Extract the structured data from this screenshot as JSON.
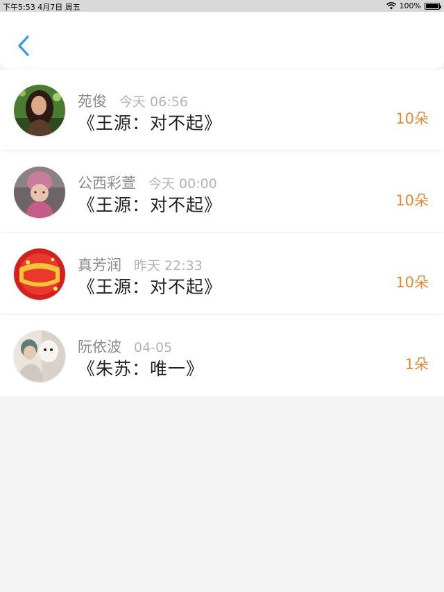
{
  "status_bar": {
    "time_date": "下午5:53   4月7日 周五",
    "battery": "100%",
    "battery_level": 1.0
  },
  "nav": {
    "back_icon": "chevron-left-icon",
    "accent_color": "#2f9bea"
  },
  "gifts": [
    {
      "name": "苑俊",
      "time": "今天 06:56",
      "song": "《王源：对不起》",
      "count": "10朵"
    },
    {
      "name": "公西彩萱",
      "time": "今天 00:00",
      "song": "《王源：对不起》",
      "count": "10朵"
    },
    {
      "name": "真芳润",
      "time": "昨天 22:33",
      "song": "《王源：对不起》",
      "count": "10朵"
    },
    {
      "name": "阮依波",
      "time": "04-05",
      "song": "《朱苏：唯一》",
      "count": "1朵"
    }
  ],
  "colors": {
    "count_accent": "#e08a3a",
    "name_gray": "#8a8a8a",
    "time_gray": "#b3b3b3"
  }
}
